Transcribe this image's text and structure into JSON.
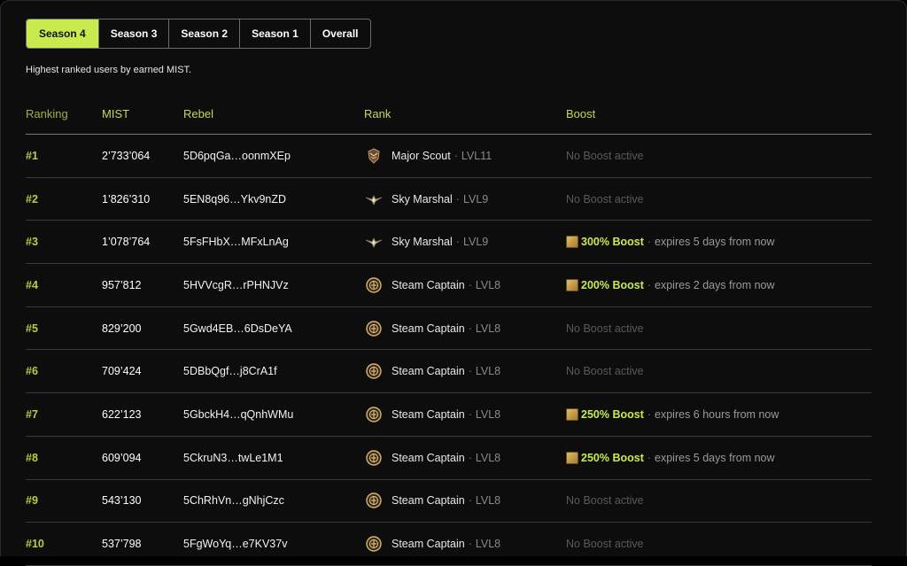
{
  "tabs": [
    {
      "label": "Season 4",
      "active": true
    },
    {
      "label": "Season 3",
      "active": false
    },
    {
      "label": "Season 2",
      "active": false
    },
    {
      "label": "Season 1",
      "active": false
    },
    {
      "label": "Overall",
      "active": false
    }
  ],
  "subtitle": "Highest ranked users by earned MIST.",
  "columns": {
    "ranking": "Ranking",
    "mist": "MIST",
    "rebel": "Rebel",
    "rank": "Rank",
    "boost": "Boost"
  },
  "rows": [
    {
      "pos": "#1",
      "mist": "2’733’064",
      "rebel": "5D6pqGa…oonmXEp",
      "rank": "Major Scout",
      "rank_icon": "major-scout-icon",
      "lvl": "LVL11",
      "boost": null,
      "boost_text": "No Boost active"
    },
    {
      "pos": "#2",
      "mist": "1’826’310",
      "rebel": "5EN8q96…Ykv9nZD",
      "rank": "Sky Marshal",
      "rank_icon": "sky-marshal-icon",
      "lvl": "LVL9",
      "boost": null,
      "boost_text": "No Boost active"
    },
    {
      "pos": "#3",
      "mist": "1’078’764",
      "rebel": "5FsFHbX…MFxLnAg",
      "rank": "Sky Marshal",
      "rank_icon": "sky-marshal-icon",
      "lvl": "LVL9",
      "boost": "300% Boost",
      "boost_text": "expires 5 days from now"
    },
    {
      "pos": "#4",
      "mist": "957’812",
      "rebel": "5HVVcgR…rPHNJVz",
      "rank": "Steam Captain",
      "rank_icon": "steam-captain-icon",
      "lvl": "LVL8",
      "boost": "200% Boost",
      "boost_text": "expires 2 days from now"
    },
    {
      "pos": "#5",
      "mist": "829’200",
      "rebel": "5Gwd4EB…6DsDeYA",
      "rank": "Steam Captain",
      "rank_icon": "steam-captain-icon",
      "lvl": "LVL8",
      "boost": null,
      "boost_text": "No Boost active"
    },
    {
      "pos": "#6",
      "mist": "709’424",
      "rebel": "5DBbQgf…j8CrA1f",
      "rank": "Steam Captain",
      "rank_icon": "steam-captain-icon",
      "lvl": "LVL8",
      "boost": null,
      "boost_text": "No Boost active"
    },
    {
      "pos": "#7",
      "mist": "622’123",
      "rebel": "5GbckH4…qQnhWMu",
      "rank": "Steam Captain",
      "rank_icon": "steam-captain-icon",
      "lvl": "LVL8",
      "boost": "250% Boost",
      "boost_text": "expires 6 hours from now"
    },
    {
      "pos": "#8",
      "mist": "609’094",
      "rebel": "5CkruN3…twLe1M1",
      "rank": "Steam Captain",
      "rank_icon": "steam-captain-icon",
      "lvl": "LVL8",
      "boost": "250% Boost",
      "boost_text": "expires 5 days from now"
    },
    {
      "pos": "#9",
      "mist": "543’130",
      "rebel": "5ChRhVn…gNhjCzc",
      "rank": "Steam Captain",
      "rank_icon": "steam-captain-icon",
      "lvl": "LVL8",
      "boost": null,
      "boost_text": "No Boost active"
    },
    {
      "pos": "#10",
      "mist": "537’798",
      "rebel": "5FgWoYq…e7KV37v",
      "rank": "Steam Captain",
      "rank_icon": "steam-captain-icon",
      "lvl": "LVL8",
      "boost": null,
      "boost_text": "No Boost active"
    }
  ],
  "separator": "·",
  "colors": {
    "accent": "#c8ea4f",
    "background": "#0d0d0d"
  }
}
